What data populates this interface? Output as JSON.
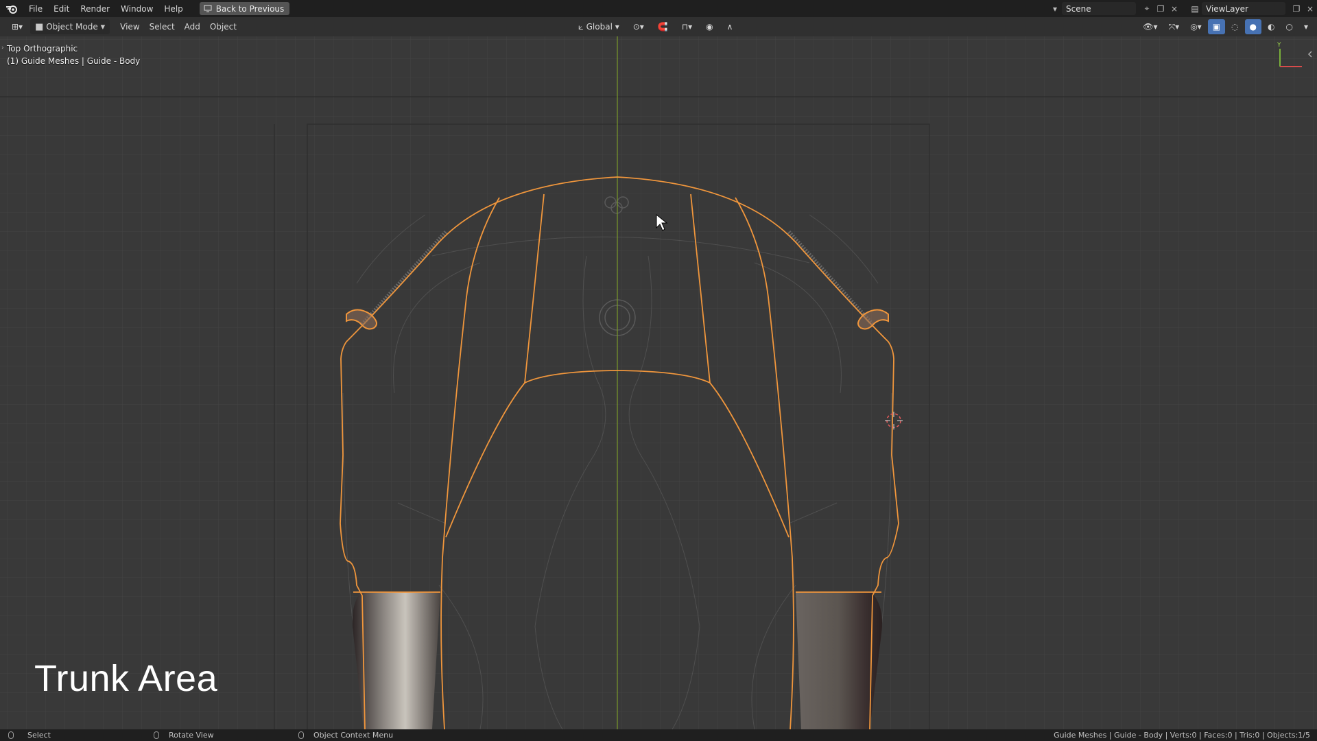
{
  "topbar": {
    "menus": [
      "File",
      "Edit",
      "Render",
      "Window",
      "Help"
    ],
    "back_button": "Back to Previous",
    "scene": "Scene",
    "view_layer": "ViewLayer"
  },
  "viewport_header": {
    "mode": "Object Mode",
    "menus": [
      "View",
      "Select",
      "Add",
      "Object"
    ],
    "orientation": "Global"
  },
  "viewport": {
    "view_name": "Top Orthographic",
    "collection_info": "(1) Guide Meshes | Guide - Body",
    "overlay_title": "Trunk Area",
    "gizmo_axis_label": "Y",
    "colors": {
      "selection_outline": "#f0963c",
      "y_axis": "#7a9a2a",
      "grid": "#454545"
    }
  },
  "statusbar": {
    "select": "Select",
    "rotate": "Rotate View",
    "context_menu": "Object Context Menu",
    "stats": "Guide Meshes | Guide - Body | Verts:0 | Faces:0 | Tris:0 | Objects:1/5"
  }
}
